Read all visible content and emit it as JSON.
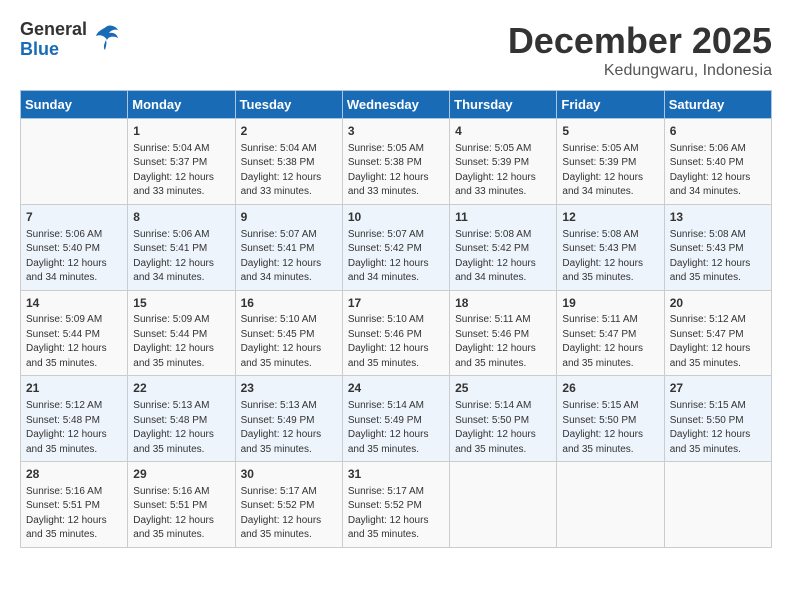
{
  "header": {
    "logo_general": "General",
    "logo_blue": "Blue",
    "month": "December 2025",
    "location": "Kedungwaru, Indonesia"
  },
  "days_of_week": [
    "Sunday",
    "Monday",
    "Tuesday",
    "Wednesday",
    "Thursday",
    "Friday",
    "Saturday"
  ],
  "weeks": [
    [
      {
        "day": "",
        "sunrise": "",
        "sunset": "",
        "daylight": ""
      },
      {
        "day": "1",
        "sunrise": "Sunrise: 5:04 AM",
        "sunset": "Sunset: 5:37 PM",
        "daylight": "Daylight: 12 hours and 33 minutes."
      },
      {
        "day": "2",
        "sunrise": "Sunrise: 5:04 AM",
        "sunset": "Sunset: 5:38 PM",
        "daylight": "Daylight: 12 hours and 33 minutes."
      },
      {
        "day": "3",
        "sunrise": "Sunrise: 5:05 AM",
        "sunset": "Sunset: 5:38 PM",
        "daylight": "Daylight: 12 hours and 33 minutes."
      },
      {
        "day": "4",
        "sunrise": "Sunrise: 5:05 AM",
        "sunset": "Sunset: 5:39 PM",
        "daylight": "Daylight: 12 hours and 33 minutes."
      },
      {
        "day": "5",
        "sunrise": "Sunrise: 5:05 AM",
        "sunset": "Sunset: 5:39 PM",
        "daylight": "Daylight: 12 hours and 34 minutes."
      },
      {
        "day": "6",
        "sunrise": "Sunrise: 5:06 AM",
        "sunset": "Sunset: 5:40 PM",
        "daylight": "Daylight: 12 hours and 34 minutes."
      }
    ],
    [
      {
        "day": "7",
        "sunrise": "Sunrise: 5:06 AM",
        "sunset": "Sunset: 5:40 PM",
        "daylight": "Daylight: 12 hours and 34 minutes."
      },
      {
        "day": "8",
        "sunrise": "Sunrise: 5:06 AM",
        "sunset": "Sunset: 5:41 PM",
        "daylight": "Daylight: 12 hours and 34 minutes."
      },
      {
        "day": "9",
        "sunrise": "Sunrise: 5:07 AM",
        "sunset": "Sunset: 5:41 PM",
        "daylight": "Daylight: 12 hours and 34 minutes."
      },
      {
        "day": "10",
        "sunrise": "Sunrise: 5:07 AM",
        "sunset": "Sunset: 5:42 PM",
        "daylight": "Daylight: 12 hours and 34 minutes."
      },
      {
        "day": "11",
        "sunrise": "Sunrise: 5:08 AM",
        "sunset": "Sunset: 5:42 PM",
        "daylight": "Daylight: 12 hours and 34 minutes."
      },
      {
        "day": "12",
        "sunrise": "Sunrise: 5:08 AM",
        "sunset": "Sunset: 5:43 PM",
        "daylight": "Daylight: 12 hours and 35 minutes."
      },
      {
        "day": "13",
        "sunrise": "Sunrise: 5:08 AM",
        "sunset": "Sunset: 5:43 PM",
        "daylight": "Daylight: 12 hours and 35 minutes."
      }
    ],
    [
      {
        "day": "14",
        "sunrise": "Sunrise: 5:09 AM",
        "sunset": "Sunset: 5:44 PM",
        "daylight": "Daylight: 12 hours and 35 minutes."
      },
      {
        "day": "15",
        "sunrise": "Sunrise: 5:09 AM",
        "sunset": "Sunset: 5:44 PM",
        "daylight": "Daylight: 12 hours and 35 minutes."
      },
      {
        "day": "16",
        "sunrise": "Sunrise: 5:10 AM",
        "sunset": "Sunset: 5:45 PM",
        "daylight": "Daylight: 12 hours and 35 minutes."
      },
      {
        "day": "17",
        "sunrise": "Sunrise: 5:10 AM",
        "sunset": "Sunset: 5:46 PM",
        "daylight": "Daylight: 12 hours and 35 minutes."
      },
      {
        "day": "18",
        "sunrise": "Sunrise: 5:11 AM",
        "sunset": "Sunset: 5:46 PM",
        "daylight": "Daylight: 12 hours and 35 minutes."
      },
      {
        "day": "19",
        "sunrise": "Sunrise: 5:11 AM",
        "sunset": "Sunset: 5:47 PM",
        "daylight": "Daylight: 12 hours and 35 minutes."
      },
      {
        "day": "20",
        "sunrise": "Sunrise: 5:12 AM",
        "sunset": "Sunset: 5:47 PM",
        "daylight": "Daylight: 12 hours and 35 minutes."
      }
    ],
    [
      {
        "day": "21",
        "sunrise": "Sunrise: 5:12 AM",
        "sunset": "Sunset: 5:48 PM",
        "daylight": "Daylight: 12 hours and 35 minutes."
      },
      {
        "day": "22",
        "sunrise": "Sunrise: 5:13 AM",
        "sunset": "Sunset: 5:48 PM",
        "daylight": "Daylight: 12 hours and 35 minutes."
      },
      {
        "day": "23",
        "sunrise": "Sunrise: 5:13 AM",
        "sunset": "Sunset: 5:49 PM",
        "daylight": "Daylight: 12 hours and 35 minutes."
      },
      {
        "day": "24",
        "sunrise": "Sunrise: 5:14 AM",
        "sunset": "Sunset: 5:49 PM",
        "daylight": "Daylight: 12 hours and 35 minutes."
      },
      {
        "day": "25",
        "sunrise": "Sunrise: 5:14 AM",
        "sunset": "Sunset: 5:50 PM",
        "daylight": "Daylight: 12 hours and 35 minutes."
      },
      {
        "day": "26",
        "sunrise": "Sunrise: 5:15 AM",
        "sunset": "Sunset: 5:50 PM",
        "daylight": "Daylight: 12 hours and 35 minutes."
      },
      {
        "day": "27",
        "sunrise": "Sunrise: 5:15 AM",
        "sunset": "Sunset: 5:50 PM",
        "daylight": "Daylight: 12 hours and 35 minutes."
      }
    ],
    [
      {
        "day": "28",
        "sunrise": "Sunrise: 5:16 AM",
        "sunset": "Sunset: 5:51 PM",
        "daylight": "Daylight: 12 hours and 35 minutes."
      },
      {
        "day": "29",
        "sunrise": "Sunrise: 5:16 AM",
        "sunset": "Sunset: 5:51 PM",
        "daylight": "Daylight: 12 hours and 35 minutes."
      },
      {
        "day": "30",
        "sunrise": "Sunrise: 5:17 AM",
        "sunset": "Sunset: 5:52 PM",
        "daylight": "Daylight: 12 hours and 35 minutes."
      },
      {
        "day": "31",
        "sunrise": "Sunrise: 5:17 AM",
        "sunset": "Sunset: 5:52 PM",
        "daylight": "Daylight: 12 hours and 35 minutes."
      },
      {
        "day": "",
        "sunrise": "",
        "sunset": "",
        "daylight": ""
      },
      {
        "day": "",
        "sunrise": "",
        "sunset": "",
        "daylight": ""
      },
      {
        "day": "",
        "sunrise": "",
        "sunset": "",
        "daylight": ""
      }
    ]
  ]
}
